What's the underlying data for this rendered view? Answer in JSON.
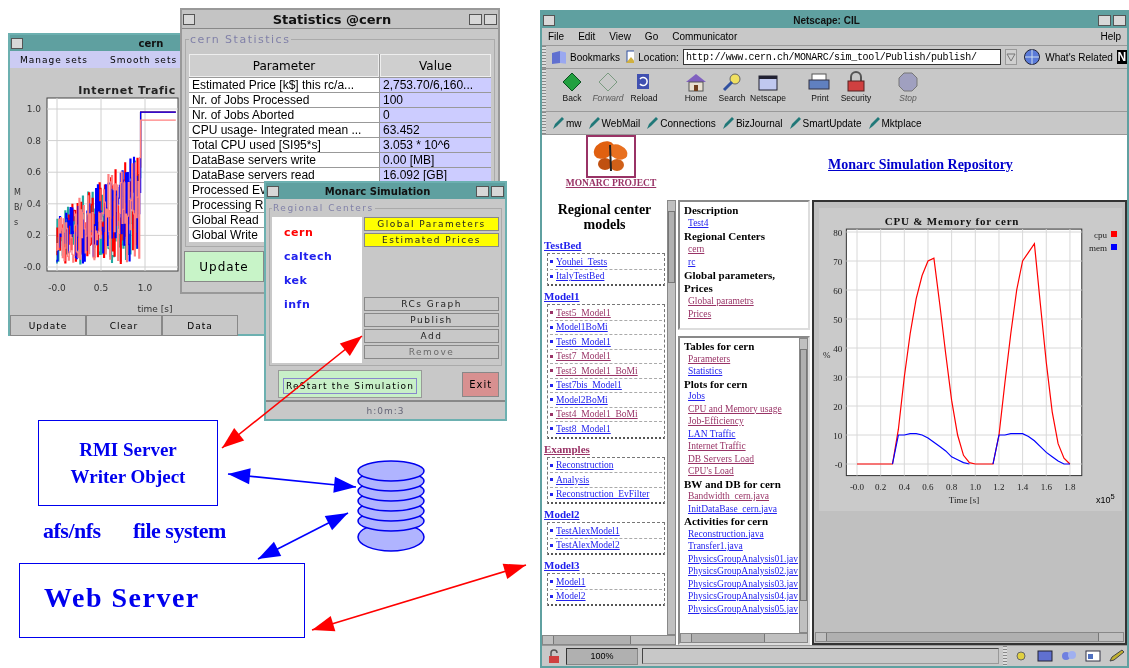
{
  "traffic_window": {
    "title": "cern",
    "menu": [
      "Manage sets",
      "Smooth sets"
    ],
    "plot": {
      "title": "Internet Trafic",
      "ylabel": "MB/s",
      "xlabel": "time [s]",
      "yticks": [
        "1.0",
        "0.8",
        "0.6",
        "0.4",
        "0.2",
        "-0.0"
      ],
      "xticks": [
        "-0.0",
        "0.5",
        "1.0"
      ]
    },
    "buttons": [
      "Update",
      "Clear",
      "Data"
    ]
  },
  "statistics_window": {
    "title": "Statistics @cern",
    "group": "cern Statistics",
    "columns": [
      "Parameter",
      "Value"
    ],
    "rows": [
      {
        "parameter": "Estimated Price [k$] this rc/a...",
        "value": "2,753.70/6,160..."
      },
      {
        "parameter": "Nr. of Jobs Processed",
        "value": "100"
      },
      {
        "parameter": "Nr. of Jobs Aborted",
        "value": "0"
      },
      {
        "parameter": "CPU usage- Integrated mean ...",
        "value": "63.452"
      },
      {
        "parameter": "Total CPU used [SI95*s]",
        "value": "3.053 * 10^6"
      },
      {
        "parameter": "DataBase servers write",
        "value": "0.00 [MB]"
      },
      {
        "parameter": "DataBase servers read",
        "value": "16.092 [GB]"
      },
      {
        "parameter": "Processed Ev"
      },
      {
        "parameter": "Processing R"
      },
      {
        "parameter": "Global Read"
      },
      {
        "parameter": "Global Write"
      }
    ],
    "button": "Update"
  },
  "simulation_window": {
    "title": "Monarc Simulation",
    "group": "Regional Centers",
    "centers": [
      {
        "name": "cern",
        "selected": true
      },
      {
        "name": "caltech",
        "selected": false
      },
      {
        "name": "kek",
        "selected": false
      },
      {
        "name": "infn",
        "selected": false
      }
    ],
    "buttons": [
      {
        "label": "Global Parameters",
        "highlighted": true,
        "disabled": false
      },
      {
        "label": "Estimated Prices",
        "highlighted": true,
        "disabled": false
      },
      {
        "label": "RCs Graph",
        "highlighted": false,
        "disabled": false
      },
      {
        "label": "Publish",
        "highlighted": false,
        "disabled": false
      },
      {
        "label": "Add",
        "highlighted": false,
        "disabled": false
      },
      {
        "label": "Remove",
        "highlighted": false,
        "disabled": true
      }
    ],
    "restart": "ReStart the Simulation",
    "exit": "Exit",
    "status": "h:0m:3"
  },
  "browser": {
    "title": "Netscape: CIL",
    "menu": [
      "File",
      "Edit",
      "View",
      "Go",
      "Communicator"
    ],
    "help": "Help",
    "bookmarks": "Bookmarks",
    "location_label": "Location:",
    "url": "http://www.cern.ch/MONARC/sim_tool/Publish/publish/",
    "related": "What's Related",
    "brand_mark": "N",
    "toolbar": [
      {
        "label": "Back",
        "disabled": false
      },
      {
        "label": "Forward",
        "disabled": true
      },
      {
        "label": "Reload",
        "disabled": false
      },
      {
        "label": "Home",
        "disabled": false
      },
      {
        "label": "Search",
        "disabled": false
      },
      {
        "label": "Netscape",
        "disabled": false
      },
      {
        "label": "Print",
        "disabled": false
      },
      {
        "label": "Security",
        "disabled": false
      },
      {
        "label": "Stop",
        "disabled": true
      }
    ],
    "personal": [
      "mw",
      "WebMail",
      "Connections",
      "BizJournal",
      "SmartUpdate",
      "Mktplace"
    ],
    "page": {
      "logo_caption": "MONARC PROJECT",
      "heading": "Monarc Simulation Repository",
      "models_title": "Regional center models",
      "groups": [
        {
          "name": "TestBed",
          "visited": false,
          "items": [
            {
              "label": "Youhei_Tests",
              "visited": false
            },
            {
              "label": "ItalyTestBed",
              "visited": false
            }
          ]
        },
        {
          "name": "Model1",
          "visited": false,
          "items": [
            {
              "label": "Test5_Model1",
              "visited": true
            },
            {
              "label": "Model1BoMi",
              "visited": false
            },
            {
              "label": "Test6_Model1",
              "visited": false
            },
            {
              "label": "Test7_Model1",
              "visited": true
            },
            {
              "label": "Test3_Model1_BoMi",
              "visited": true
            },
            {
              "label": "Test7bis_Model1",
              "visited": false
            },
            {
              "label": "Model2BoMi",
              "visited": false
            },
            {
              "label": "Test4_Model1_BoMi",
              "visited": true
            },
            {
              "label": "Test8_Model1",
              "visited": false
            }
          ]
        },
        {
          "name": "Examples",
          "visited": true,
          "items": [
            {
              "label": "Reconstruction",
              "visited": false
            },
            {
              "label": "Analysis",
              "visited": false
            },
            {
              "label": "Reconstruction_EvFilter",
              "visited": false
            }
          ]
        },
        {
          "name": "Model2",
          "visited": false,
          "items": [
            {
              "label": "TestAlexModel1",
              "visited": false
            },
            {
              "label": "TestAlexModel2",
              "visited": false
            }
          ]
        },
        {
          "name": "Model3",
          "visited": false,
          "items": [
            {
              "label": "Model1",
              "visited": false
            },
            {
              "label": "Model2",
              "visited": false
            }
          ]
        }
      ],
      "description": [
        {
          "heading": "Description",
          "links": [
            {
              "label": "Test4",
              "visited": false
            }
          ]
        },
        {
          "heading": "Regional Centers",
          "links": [
            {
              "label": "cern",
              "visited": true
            },
            {
              "label": "rc",
              "visited": false
            }
          ]
        },
        {
          "heading": "Global parameters, Prices",
          "links": [
            {
              "label": "Global parametrs",
              "visited": true
            },
            {
              "label": "Prices",
              "visited": true
            }
          ]
        }
      ],
      "details": [
        {
          "heading": "Tables for cern",
          "links": [
            {
              "label": "Parameters",
              "visited": true
            },
            {
              "label": "Statistics",
              "visited": false
            }
          ]
        },
        {
          "heading": "Plots for cern",
          "links": [
            {
              "label": "Jobs",
              "visited": false
            },
            {
              "label": "CPU and Memory usage",
              "visited": true
            },
            {
              "label": "Job-Efficiency",
              "visited": true
            },
            {
              "label": "LAN Traffic",
              "visited": false
            },
            {
              "label": "Internet Traffic",
              "visited": true
            },
            {
              "label": "DB Servers Load",
              "visited": true
            },
            {
              "label": "CPU's Load",
              "visited": true
            }
          ]
        },
        {
          "heading": "BW and DB for cern",
          "links": [
            {
              "label": "Bandwidth_cern.java",
              "visited": true
            },
            {
              "label": "InitDataBase_cern.java",
              "visited": false
            }
          ]
        },
        {
          "heading": "Activities for cern",
          "links": [
            {
              "label": "Reconstruction.java",
              "visited": false
            },
            {
              "label": "Transfer1.java",
              "visited": false
            },
            {
              "label": "PhysicsGroupAnalysis01.jav",
              "visited": false
            },
            {
              "label": "PhysicsGroupAnalysis02.jav",
              "visited": false
            },
            {
              "label": "PhysicsGroupAnalysis03.jav",
              "visited": false
            },
            {
              "label": "PhysicsGroupAnalysis04.jav",
              "visited": false
            },
            {
              "label": "PhysicsGroupAnalysis05.jav",
              "visited": false
            }
          ]
        }
      ],
      "chart_data": {
        "type": "line",
        "title": "CPU & Memory for cern",
        "xlabel": "Time [s]",
        "ylabel": "%",
        "x": [
          0,
          0.05,
          0.1,
          0.15,
          0.2,
          0.25,
          0.3,
          0.35,
          0.4,
          0.45,
          0.5,
          0.55,
          0.6,
          0.65,
          0.7,
          0.75,
          0.8,
          0.85,
          0.9,
          0.95,
          1.0,
          1.05,
          1.1,
          1.15,
          1.2,
          1.25,
          1.3,
          1.35,
          1.4,
          1.45,
          1.5,
          1.55,
          1.6,
          1.65,
          1.7,
          1.75,
          1.8
        ],
        "series": [
          {
            "name": "cpu",
            "color": "#ff0000",
            "values": [
              0,
              0,
              0,
              0,
              0,
              0,
              0,
              12,
              30,
              45,
              57,
              65,
              70,
              71,
              55,
              38,
              22,
              10,
              3,
              0.5,
              0,
              0,
              0,
              0,
              10,
              28,
              45,
              60,
              70,
              73,
              76,
              55,
              35,
              18,
              7,
              2,
              0
            ]
          },
          {
            "name": "mem",
            "color": "#0000ff",
            "values": [
              null,
              null,
              null,
              null,
              null,
              null,
              0,
              10,
              10,
              10.5,
              10.5,
              10,
              9,
              7.5,
              6,
              4.5,
              2.5,
              1.5,
              0.5,
              0,
              null,
              null,
              null,
              0,
              10,
              10,
              10.5,
              10.5,
              10.5,
              9.5,
              8,
              6,
              4,
              2.5,
              1,
              0,
              0
            ]
          }
        ],
        "grid": true,
        "legend": "right",
        "xlim": [
          -0.09,
          1.9
        ],
        "ylim": [
          -4,
          81
        ],
        "xticks": [
          {
            "value": 0,
            "label": "-0.0"
          },
          {
            "value": 0.2,
            "label": "0.2"
          },
          {
            "value": 0.4,
            "label": "0.4"
          },
          {
            "value": 0.6,
            "label": "0.6"
          },
          {
            "value": 0.8,
            "label": "0.8"
          },
          {
            "value": 1.0,
            "label": "1.0"
          },
          {
            "value": 1.2,
            "label": "1.2"
          },
          {
            "value": 1.4,
            "label": "1.4"
          },
          {
            "value": 1.6,
            "label": "1.6"
          },
          {
            "value": 1.8,
            "label": "1.8"
          }
        ],
        "yticks": [
          {
            "value": 0,
            "label": "-0"
          },
          10,
          20,
          30,
          40,
          50,
          60,
          70,
          80
        ],
        "annotations": [
          "x10$^{5}$"
        ]
      }
    },
    "status": {
      "zoom": "100%"
    }
  },
  "diagram": {
    "rmi_server": [
      "RMI Server",
      "Writer Object"
    ],
    "labels": [
      "afs/nfs",
      "file system"
    ],
    "web_server": "Web Server"
  }
}
